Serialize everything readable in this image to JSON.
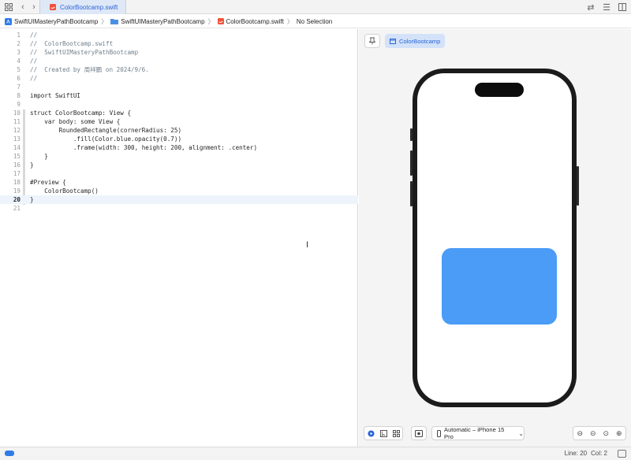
{
  "tab": {
    "label": "ColorBootcamp.swift"
  },
  "breadcrumb": {
    "items": [
      "SwiftUIMasteryPathBootcamp",
      "SwiftUIMasteryPathBootcamp",
      "ColorBootcamp.swift",
      "No Selection"
    ],
    "separator": "〉"
  },
  "editor": {
    "active_line": 20,
    "lines": [
      {
        "n": "1",
        "text": "//"
      },
      {
        "n": "2",
        "text": "//  ColorBootcamp.swift"
      },
      {
        "n": "3",
        "text": "//  SwiftUIMasteryPathBootcamp"
      },
      {
        "n": "4",
        "text": "//"
      },
      {
        "n": "5",
        "text": "//  Created by 周祥鹏 on 2024/9/6."
      },
      {
        "n": "6",
        "text": "//"
      },
      {
        "n": "7",
        "text": ""
      },
      {
        "n": "8",
        "text": "import SwiftUI"
      },
      {
        "n": "9",
        "text": ""
      },
      {
        "n": "10",
        "text": "struct ColorBootcamp: View {"
      },
      {
        "n": "11",
        "text": "    var body: some View {"
      },
      {
        "n": "12",
        "text": "        RoundedRectangle(cornerRadius: 25)"
      },
      {
        "n": "13",
        "text": "            .fill(Color.blue.opacity(0.7))"
      },
      {
        "n": "14",
        "text": "            .frame(width: 300, height: 200, alignment: .center)"
      },
      {
        "n": "15",
        "text": "    }"
      },
      {
        "n": "16",
        "text": "}"
      },
      {
        "n": "17",
        "text": ""
      },
      {
        "n": "18",
        "text": "#Preview {"
      },
      {
        "n": "19",
        "text": "    ColorBootcamp()"
      },
      {
        "n": "20",
        "text": "}"
      },
      {
        "n": "21",
        "text": ""
      }
    ]
  },
  "canvas": {
    "preview_chip": "ColorBootcamp",
    "device_select": "Automatic – iPhone 15 Pro",
    "preview_rect_color": "#4a9cf7"
  },
  "statusbar": {
    "line": "Line: 20",
    "col": "Col: 2",
    "pill_color": "#2f7be8"
  }
}
